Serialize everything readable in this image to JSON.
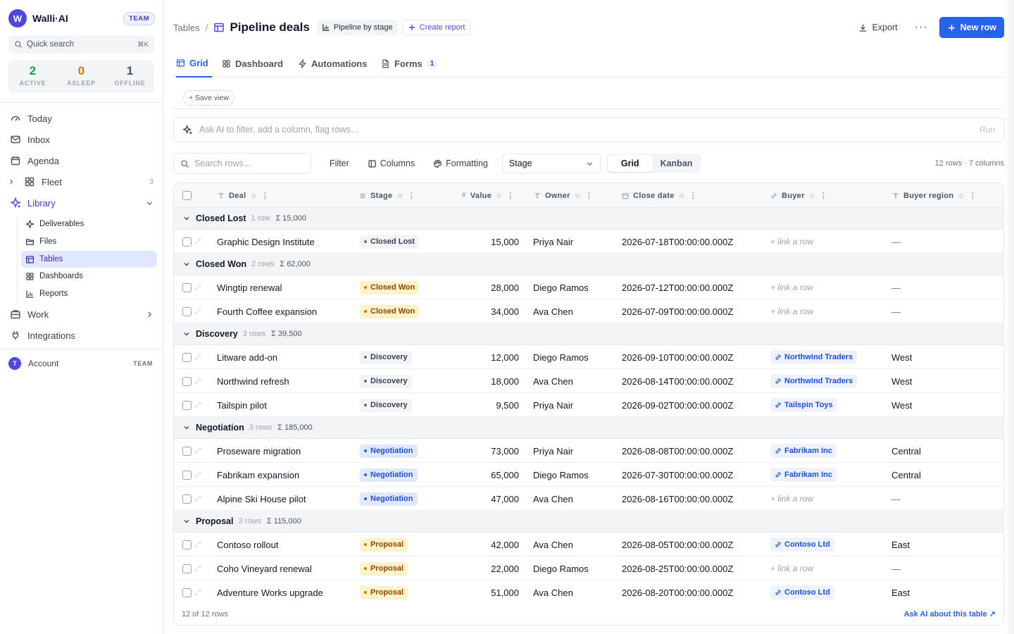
{
  "brand": {
    "logo_letter": "W",
    "name": "Walli·AI",
    "badge": "TEAM"
  },
  "quick_search": {
    "label": "Quick search",
    "shortcut": "⌘K"
  },
  "stats": [
    {
      "num": "2",
      "label": "ACTIVE",
      "color": "#16a34a"
    },
    {
      "num": "0",
      "label": "ASLEEP",
      "color": "#d97706"
    },
    {
      "num": "1",
      "label": "OFFLINE",
      "color": "#475569"
    }
  ],
  "nav": {
    "today": "Today",
    "inbox": "Inbox",
    "agenda": "Agenda",
    "fleet": "Fleet",
    "fleet_count": "3",
    "library": "Library",
    "work": "Work",
    "integrations": "Integrations"
  },
  "library_items": [
    "Deliverables",
    "Files",
    "Tables",
    "Dashboards",
    "Reports"
  ],
  "account": {
    "avatar_letter": "T",
    "label": "Account",
    "badge": "TEAM"
  },
  "breadcrumb": {
    "parent": "Tables",
    "separator": "/",
    "title": "Pipeline deals"
  },
  "header_pills": {
    "pipeline": "Pipeline by stage",
    "create_report": "Create report"
  },
  "actions": {
    "export": "Export",
    "more": "···",
    "new_row": "New row"
  },
  "tabs": {
    "grid": "Grid",
    "dashboard": "Dashboard",
    "automations": "Automations",
    "forms": "Forms",
    "forms_badge": "1"
  },
  "save_view": "+ Save view",
  "ai_bar": {
    "placeholder": "Ask AI to filter, add a column, flag rows…",
    "run": "Run"
  },
  "toolbar": {
    "search_placeholder": "Search rows…",
    "filter": "Filter",
    "columns": "Columns",
    "formatting": "Formatting",
    "group_by": "Stage",
    "view_grid": "Grid",
    "view_kanban": "Kanban",
    "row_count": "12 rows · 7 columns"
  },
  "columns": {
    "deal": "Deal",
    "stage": "Stage",
    "value": "Value",
    "owner": "Owner",
    "close_date": "Close date",
    "buyer": "Buyer",
    "buyer_region": "Buyer region"
  },
  "link_placeholder": "+ link a row",
  "empty_cell": "—",
  "stage_colors": {
    "Closed Lost": {
      "bg": "#f3f4f6",
      "fg": "#374151",
      "dot": "#6b7280"
    },
    "Closed Won": {
      "bg": "#fef3c7",
      "fg": "#92400e",
      "dot": "#d97706"
    },
    "Discovery": {
      "bg": "#f3f4f6",
      "fg": "#374151",
      "dot": "#6b7280"
    },
    "Negotiation": {
      "bg": "#e0e7ff",
      "fg": "#1d4ed8",
      "dot": "#2563eb"
    },
    "Proposal": {
      "bg": "#fef3c7",
      "fg": "#92400e",
      "dot": "#d97706"
    }
  },
  "groups": [
    {
      "name": "Closed Lost",
      "count": "1 row",
      "sum": "Σ 15,000",
      "rows": [
        {
          "deal": "Graphic Design Institute",
          "stage": "Closed Lost",
          "value": "15,000",
          "owner": "Priya Nair",
          "close_date": "2026-07-18T00:00:00.000Z",
          "buyer": "",
          "region": ""
        }
      ]
    },
    {
      "name": "Closed Won",
      "count": "2 rows",
      "sum": "Σ 62,000",
      "rows": [
        {
          "deal": "Wingtip renewal",
          "stage": "Closed Won",
          "value": "28,000",
          "owner": "Diego Ramos",
          "close_date": "2026-07-12T00:00:00.000Z",
          "buyer": "",
          "region": ""
        },
        {
          "deal": "Fourth Coffee expansion",
          "stage": "Closed Won",
          "value": "34,000",
          "owner": "Ava Chen",
          "close_date": "2026-07-09T00:00:00.000Z",
          "buyer": "",
          "region": ""
        }
      ]
    },
    {
      "name": "Discovery",
      "count": "3 rows",
      "sum": "Σ 39,500",
      "rows": [
        {
          "deal": "Litware add-on",
          "stage": "Discovery",
          "value": "12,000",
          "owner": "Diego Ramos",
          "close_date": "2026-09-10T00:00:00.000Z",
          "buyer": "Northwind Traders",
          "region": "West"
        },
        {
          "deal": "Northwind refresh",
          "stage": "Discovery",
          "value": "18,000",
          "owner": "Ava Chen",
          "close_date": "2026-08-14T00:00:00.000Z",
          "buyer": "Northwind Traders",
          "region": "West"
        },
        {
          "deal": "Tailspin pilot",
          "stage": "Discovery",
          "value": "9,500",
          "owner": "Priya Nair",
          "close_date": "2026-09-02T00:00:00.000Z",
          "buyer": "Tailspin Toys",
          "region": "West"
        }
      ]
    },
    {
      "name": "Negotiation",
      "count": "3 rows",
      "sum": "Σ 185,000",
      "rows": [
        {
          "deal": "Proseware migration",
          "stage": "Negotiation",
          "value": "73,000",
          "owner": "Priya Nair",
          "close_date": "2026-08-08T00:00:00.000Z",
          "buyer": "Fabrikam Inc",
          "region": "Central"
        },
        {
          "deal": "Fabrikam expansion",
          "stage": "Negotiation",
          "value": "65,000",
          "owner": "Diego Ramos",
          "close_date": "2026-07-30T00:00:00.000Z",
          "buyer": "Fabrikam Inc",
          "region": "Central"
        },
        {
          "deal": "Alpine Ski House pilot",
          "stage": "Negotiation",
          "value": "47,000",
          "owner": "Ava Chen",
          "close_date": "2026-08-16T00:00:00.000Z",
          "buyer": "",
          "region": ""
        }
      ]
    },
    {
      "name": "Proposal",
      "count": "3 rows",
      "sum": "Σ 115,000",
      "rows": [
        {
          "deal": "Contoso rollout",
          "stage": "Proposal",
          "value": "42,000",
          "owner": "Ava Chen",
          "close_date": "2026-08-05T00:00:00.000Z",
          "buyer": "Contoso Ltd",
          "region": "East"
        },
        {
          "deal": "Coho Vineyard renewal",
          "stage": "Proposal",
          "value": "22,000",
          "owner": "Diego Ramos",
          "close_date": "2026-08-25T00:00:00.000Z",
          "buyer": "",
          "region": ""
        },
        {
          "deal": "Adventure Works upgrade",
          "stage": "Proposal",
          "value": "51,000",
          "owner": "Ava Chen",
          "close_date": "2026-08-20T00:00:00.000Z",
          "buyer": "Contoso Ltd",
          "region": "East"
        }
      ]
    }
  ],
  "footer": {
    "count": "12 of 12 rows",
    "ask_ai": "Ask AI about this table ↗"
  }
}
